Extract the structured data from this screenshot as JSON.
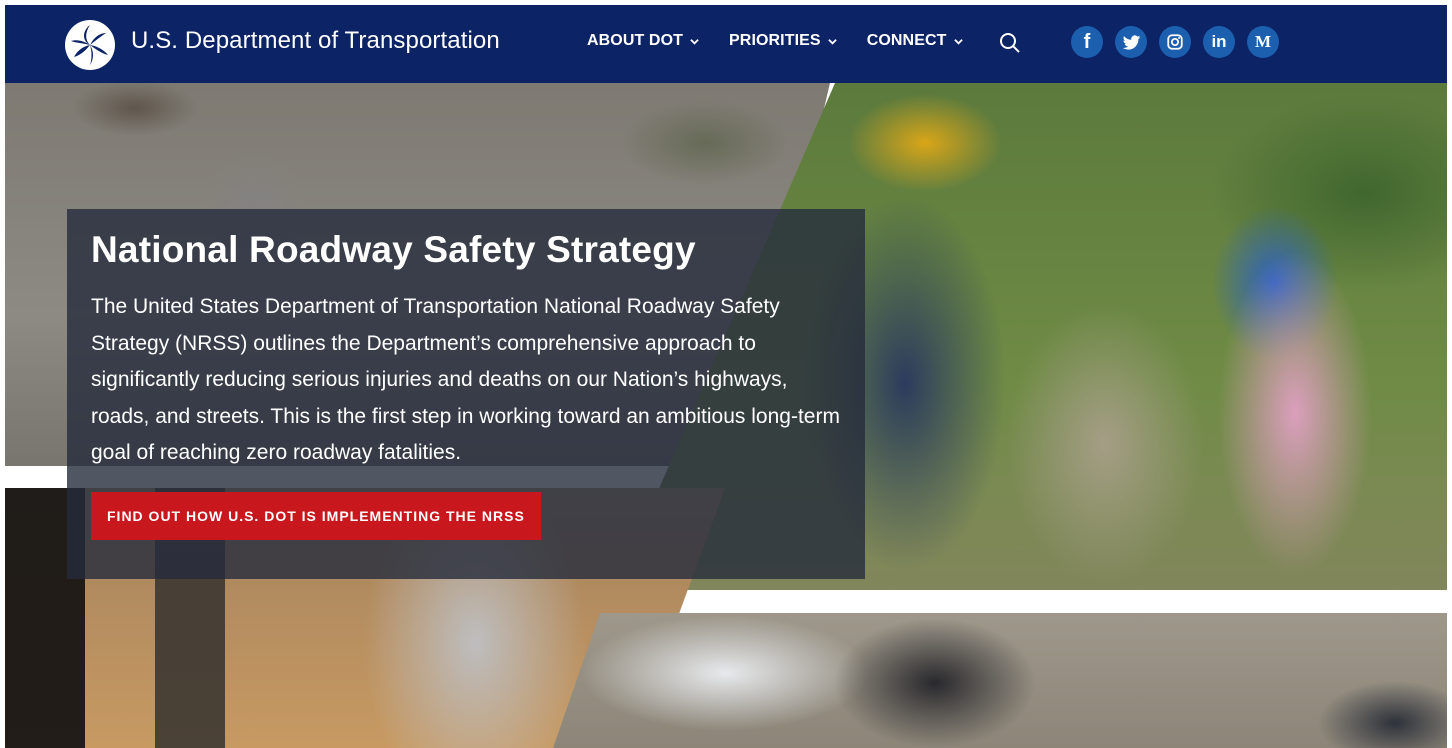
{
  "header": {
    "site_title": "U.S. Department of Transportation",
    "nav": [
      {
        "label": "ABOUT DOT"
      },
      {
        "label": "PRIORITIES"
      },
      {
        "label": "CONNECT"
      }
    ],
    "social": [
      "f",
      "in",
      "M"
    ]
  },
  "hero": {
    "title": "National Roadway Safety Strategy",
    "description": "The United States Department of Transportation National Roadway Safety Strategy (NRSS) outlines the Department’s comprehensive approach to significantly reducing serious injuries and deaths on our Nation’s highways, roads, and streets. This is the first step in working toward an ambitious long-term goal of reaching zero roadway fatalities.",
    "cta_label": "FIND OUT HOW U.S. DOT IS IMPLEMENTING THE NRSS"
  },
  "colors": {
    "header_bg": "#0c2366",
    "social_bg": "#1c5fae",
    "cta_bg": "#c8171d"
  },
  "icons": {
    "logo": "dot-logo-icon",
    "search": "search-icon",
    "chevron": "chevron-down-icon",
    "facebook": "facebook-icon",
    "twitter": "twitter-icon",
    "instagram": "instagram-icon",
    "linkedin": "linkedin-icon",
    "medium": "medium-icon"
  }
}
